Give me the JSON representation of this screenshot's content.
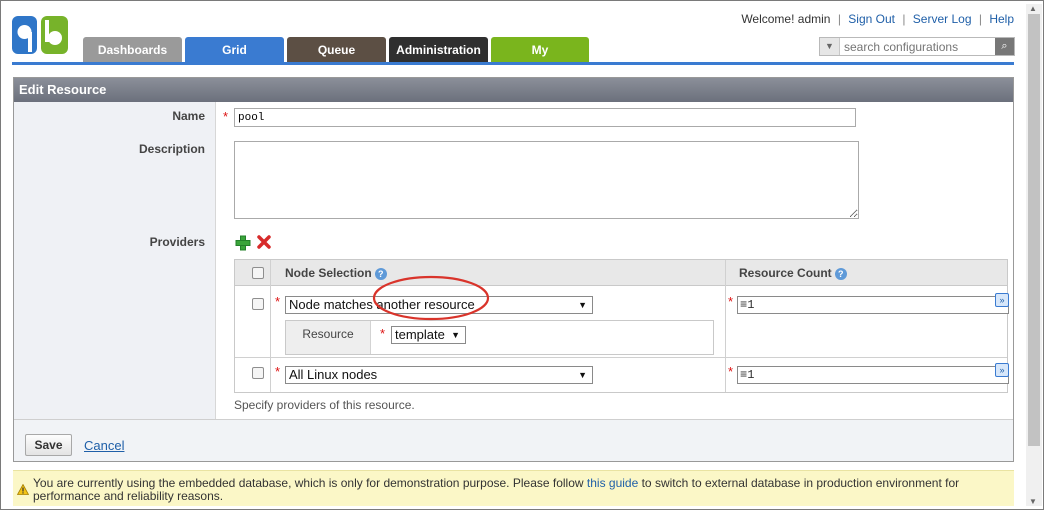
{
  "header": {
    "welcome": "Welcome! admin",
    "links": [
      "Sign Out",
      "Server Log",
      "Help"
    ],
    "tabs": [
      "Dashboards",
      "Grid",
      "Queue",
      "Administration",
      "My"
    ],
    "search_placeholder": "search configurations"
  },
  "panel": {
    "title": "Edit Resource",
    "name_label": "Name",
    "name_value": "pool",
    "description_label": "Description",
    "description_value": "",
    "providers_label": "Providers",
    "table": {
      "col_node": "Node Selection",
      "col_count": "Resource Count",
      "help_glyph": "?",
      "rows": [
        {
          "node": "Node matches another resource",
          "count": "≡1",
          "resource_label": "Resource",
          "resource_value": "template"
        },
        {
          "node": "All Linux nodes",
          "count": "≡1"
        }
      ]
    },
    "hint": "Specify providers of this resource.",
    "save": "Save",
    "cancel": "Cancel"
  },
  "notice": {
    "before": "You are currently using the embedded database, which is only for demonstration purpose. Please follow ",
    "link": "this guide",
    "after": " to switch to external database in production environment for performance and reliability reasons."
  },
  "colors": {
    "grid_tab": "#3a7bd1",
    "my_tab": "#7ab51d",
    "annotation": "#d9342b"
  },
  "annotation": "red ellipse around 'another resource'"
}
